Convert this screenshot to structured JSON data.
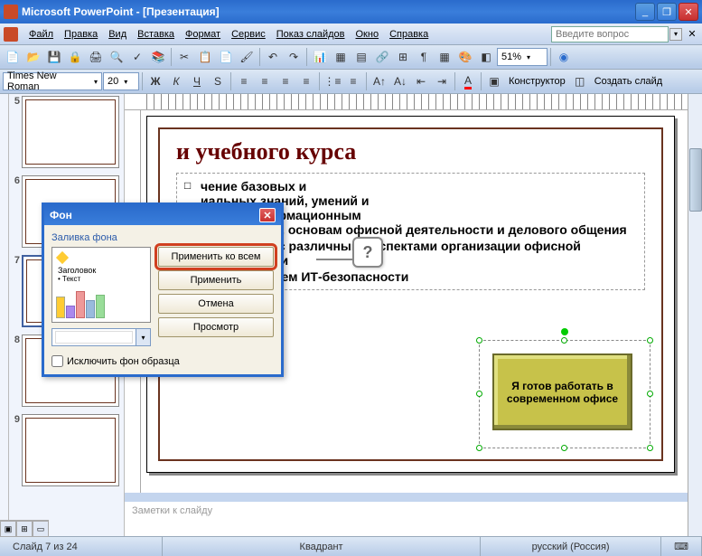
{
  "window": {
    "title": "Microsoft PowerPoint - [Презентация]"
  },
  "menu": {
    "file": "Файл",
    "edit": "Правка",
    "view": "Вид",
    "insert": "Вставка",
    "format": "Формат",
    "tools": "Сервис",
    "slideshow": "Показ слайдов",
    "window": "Окно",
    "help": "Справка",
    "question_placeholder": "Введите вопрос"
  },
  "toolbar1": {
    "zoom": "51%"
  },
  "toolbar2": {
    "font": "Times New Roman",
    "size": "20",
    "bold": "Ж",
    "italic": "К",
    "underline": "Ч",
    "shadow": "S",
    "designer": "Конструктор",
    "new_slide": "Создать слайд"
  },
  "thumbs": {
    "n5": "5",
    "n6": "6",
    "n7": "7",
    "n8": "8",
    "n9": "9"
  },
  "slide": {
    "title_partial": "и учебного курса",
    "bullets": {
      "b1_l1": "чение базовых и",
      "b1_l2": "иальных знаний, умений и",
      "b1_l3": "ков по информационным",
      "b1_l4": "технологиям, основам офисной деятельности и делового общения",
      "b2": "Знакомство с различными аспектами организации офисной деятельности",
      "b3": "Обзор проблем ИТ-безопасности"
    },
    "shape_text": "Я готов работать в современном офисе"
  },
  "dialog": {
    "title": "Фон",
    "section": "Заливка фона",
    "preview": {
      "heading": "Заголовок",
      "bullet": "Текст"
    },
    "apply_all": "Применить ко всем",
    "apply": "Применить",
    "cancel": "Отмена",
    "preview_btn": "Просмотр",
    "exclude": "Исключить фон образца"
  },
  "callout": {
    "mark": "?"
  },
  "notes": {
    "placeholder": "Заметки к слайду"
  },
  "status": {
    "slide": "Слайд 7 из 24",
    "theme": "Квадрант",
    "lang": "русский (Россия)"
  }
}
